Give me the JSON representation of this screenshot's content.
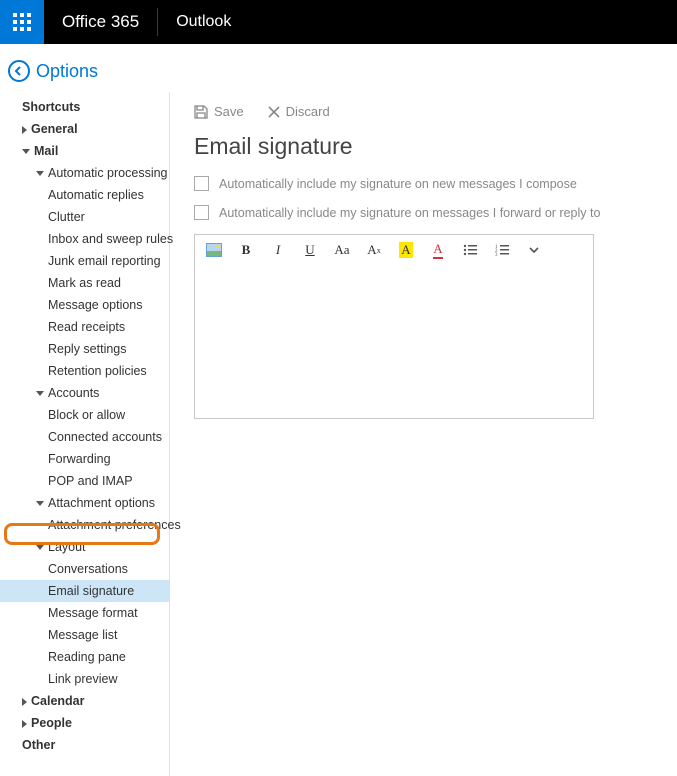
{
  "header": {
    "brand": "Office 365",
    "app": "Outlook"
  },
  "options": {
    "title": "Options"
  },
  "sidebar": {
    "shortcuts": "Shortcuts",
    "general": "General",
    "mail": "Mail",
    "auto_processing": "Automatic processing",
    "auto_replies": "Automatic replies",
    "clutter": "Clutter",
    "inbox_rules": "Inbox and sweep rules",
    "junk": "Junk email reporting",
    "mark_read": "Mark as read",
    "msg_options": "Message options",
    "read_receipts": "Read receipts",
    "reply_settings": "Reply settings",
    "retention": "Retention policies",
    "accounts": "Accounts",
    "block_allow": "Block or allow",
    "connected": "Connected accounts",
    "forwarding": "Forwarding",
    "pop_imap": "POP and IMAP",
    "attach_opts": "Attachment options",
    "attach_prefs": "Attachment preferences",
    "layout": "Layout",
    "conversations": "Conversations",
    "email_sig": "Email signature",
    "msg_format": "Message format",
    "msg_list": "Message list",
    "reading_pane": "Reading pane",
    "link_preview": "Link preview",
    "calendar": "Calendar",
    "people": "People",
    "other": "Other"
  },
  "actions": {
    "save": "Save",
    "discard": "Discard"
  },
  "page": {
    "title": "Email signature",
    "chk1": "Automatically include my signature on new messages I compose",
    "chk2": "Automatically include my signature on messages I forward or reply to"
  },
  "toolbar": {
    "bold": "B",
    "italic": "I",
    "underline": "U",
    "fontsize": "Aa",
    "super": "A",
    "highlight": "A",
    "fontcolor": "A"
  }
}
